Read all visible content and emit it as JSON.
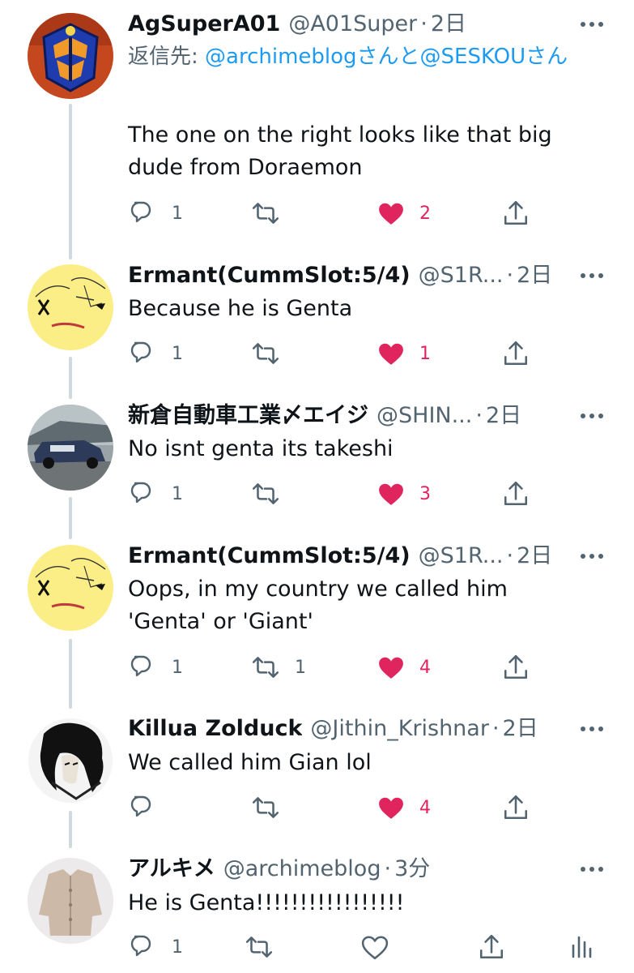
{
  "tweets": [
    {
      "name": "AgSuperA01",
      "handle": "@A01Super",
      "dot": "·",
      "time": "2日",
      "reply_prefix": "返信先: ",
      "reply_user1": "@archimeblogさんと",
      "reply_user2": "@SESKOUさん",
      "text_line1": "The one on the right looks like that big",
      "text_line2": "dude from Doraemon",
      "reply_count": "1",
      "retweet_count": "",
      "like_count": "2"
    },
    {
      "name": "Ermant(CummSlot:5/4)",
      "handle": "@S1R...",
      "dot": "·",
      "time": "2日",
      "text_line1": "Because he is Genta",
      "reply_count": "1",
      "retweet_count": "",
      "like_count": "1"
    },
    {
      "name": "新倉自動車工業〆エイジ",
      "handle": "@SHIN...",
      "dot": "·",
      "time": "2日",
      "text_line1": "No isnt genta its takeshi",
      "reply_count": "1",
      "retweet_count": "",
      "like_count": "3"
    },
    {
      "name": "Ermant(CummSlot:5/4)",
      "handle": "@S1R...",
      "dot": "·",
      "time": "2日",
      "text_line1": "Oops, in my country we called him",
      "text_line2": "'Genta' or 'Giant'",
      "reply_count": "1",
      "retweet_count": "1",
      "like_count": "4"
    },
    {
      "name": "Killua Zolduck",
      "handle": "@Jithin_Krishnar",
      "dot": "·",
      "time": "2日",
      "text_line1": "We called him Gian lol",
      "reply_count": "",
      "retweet_count": "",
      "like_count": "4"
    },
    {
      "name": "アルキメ",
      "handle": "@archimeblog",
      "dot": "·",
      "time": "3分",
      "text_line1": "He is Genta!!!!!!!!!!!!!!!!!",
      "reply_count": "1",
      "retweet_count": "",
      "like_count": ""
    }
  ],
  "colors": {
    "like": "#e0245e",
    "link": "#1d9bf0",
    "muted": "#536471",
    "thread_line": "#cfd9de"
  },
  "icons": [
    "reply-icon",
    "retweet-icon",
    "like-icon",
    "share-icon",
    "analytics-icon",
    "more-icon"
  ]
}
